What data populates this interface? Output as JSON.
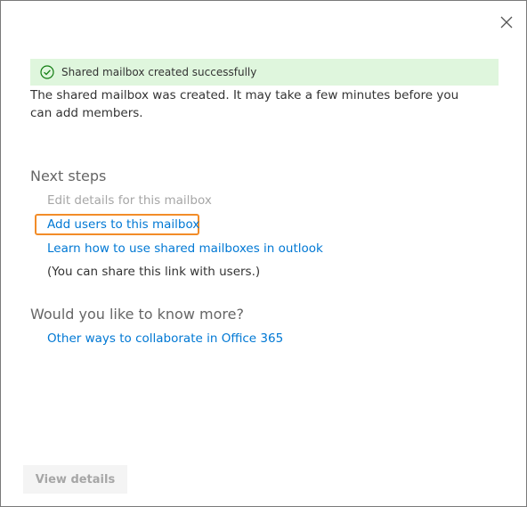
{
  "banner": {
    "message": "Shared mailbox created successfully",
    "icon": "check-circle-icon",
    "color": "#dff6dd"
  },
  "description": "The shared mailbox was created. It may take a few minutes before you can add members.",
  "next_steps": {
    "title": "Next steps",
    "items": {
      "edit_details": "Edit details for this mailbox",
      "add_users": "Add users to this mailbox",
      "learn_how": "Learn how to use shared mailboxes in outlook",
      "share_note": "(You can share this link with users.)"
    }
  },
  "know_more": {
    "title": "Would you like to know more?",
    "other_ways": "Other ways to collaborate in Office 365"
  },
  "footer": {
    "view_details_label": "View details"
  },
  "colors": {
    "link": "#0078d4",
    "highlight": "#f28c28",
    "disabled": "#a6a6a6"
  }
}
